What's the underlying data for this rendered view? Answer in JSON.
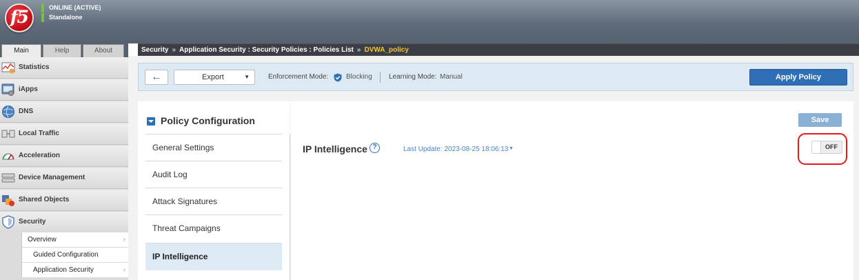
{
  "header": {
    "logo_text": "f5",
    "status": "ONLINE (ACTIVE)",
    "mode": "Standalone"
  },
  "tabs": [
    "Main",
    "Help",
    "About"
  ],
  "nav": {
    "items": [
      {
        "label": "Statistics",
        "icon": "statistics-icon"
      },
      {
        "label": "iApps",
        "icon": "iapps-icon"
      },
      {
        "label": "DNS",
        "icon": "dns-globe-icon"
      },
      {
        "label": "Local Traffic",
        "icon": "local-traffic-icon"
      },
      {
        "label": "Acceleration",
        "icon": "gauge-icon"
      },
      {
        "label": "Device Management",
        "icon": "device-icon"
      },
      {
        "label": "Shared Objects",
        "icon": "shared-objects-icon"
      },
      {
        "label": "Security",
        "icon": "shield-icon"
      }
    ],
    "security_sub": [
      "Overview",
      "Guided Configuration",
      "Application Security"
    ]
  },
  "breadcrumb": {
    "parts": [
      "Security",
      "Application Security : Security Policies : Policies List"
    ],
    "separator": "»",
    "current": "DVWA_policy"
  },
  "toolbar": {
    "back_label": "←",
    "export_label": "Export",
    "enforcement_label": "Enforcement Mode:",
    "enforcement_value": "Blocking",
    "learning_label": "Learning Mode:",
    "learning_value": "Manual",
    "apply_label": "Apply Policy"
  },
  "policy_config": {
    "title": "Policy Configuration",
    "items": [
      "General Settings",
      "Audit Log",
      "Attack Signatures",
      "Threat Campaigns",
      "IP Intelligence"
    ],
    "active": "IP Intelligence"
  },
  "main": {
    "save_label": "Save",
    "title": "IP Intelligence",
    "help_glyph": "?",
    "last_update": "Last Update: 2023-08-25 18:06:13",
    "toggle_state": "OFF"
  },
  "colors": {
    "accent": "#2f6fb6",
    "breadcrumb_current": "#f5c430",
    "status_green": "#77c043",
    "highlight_ring": "#e8171c"
  }
}
